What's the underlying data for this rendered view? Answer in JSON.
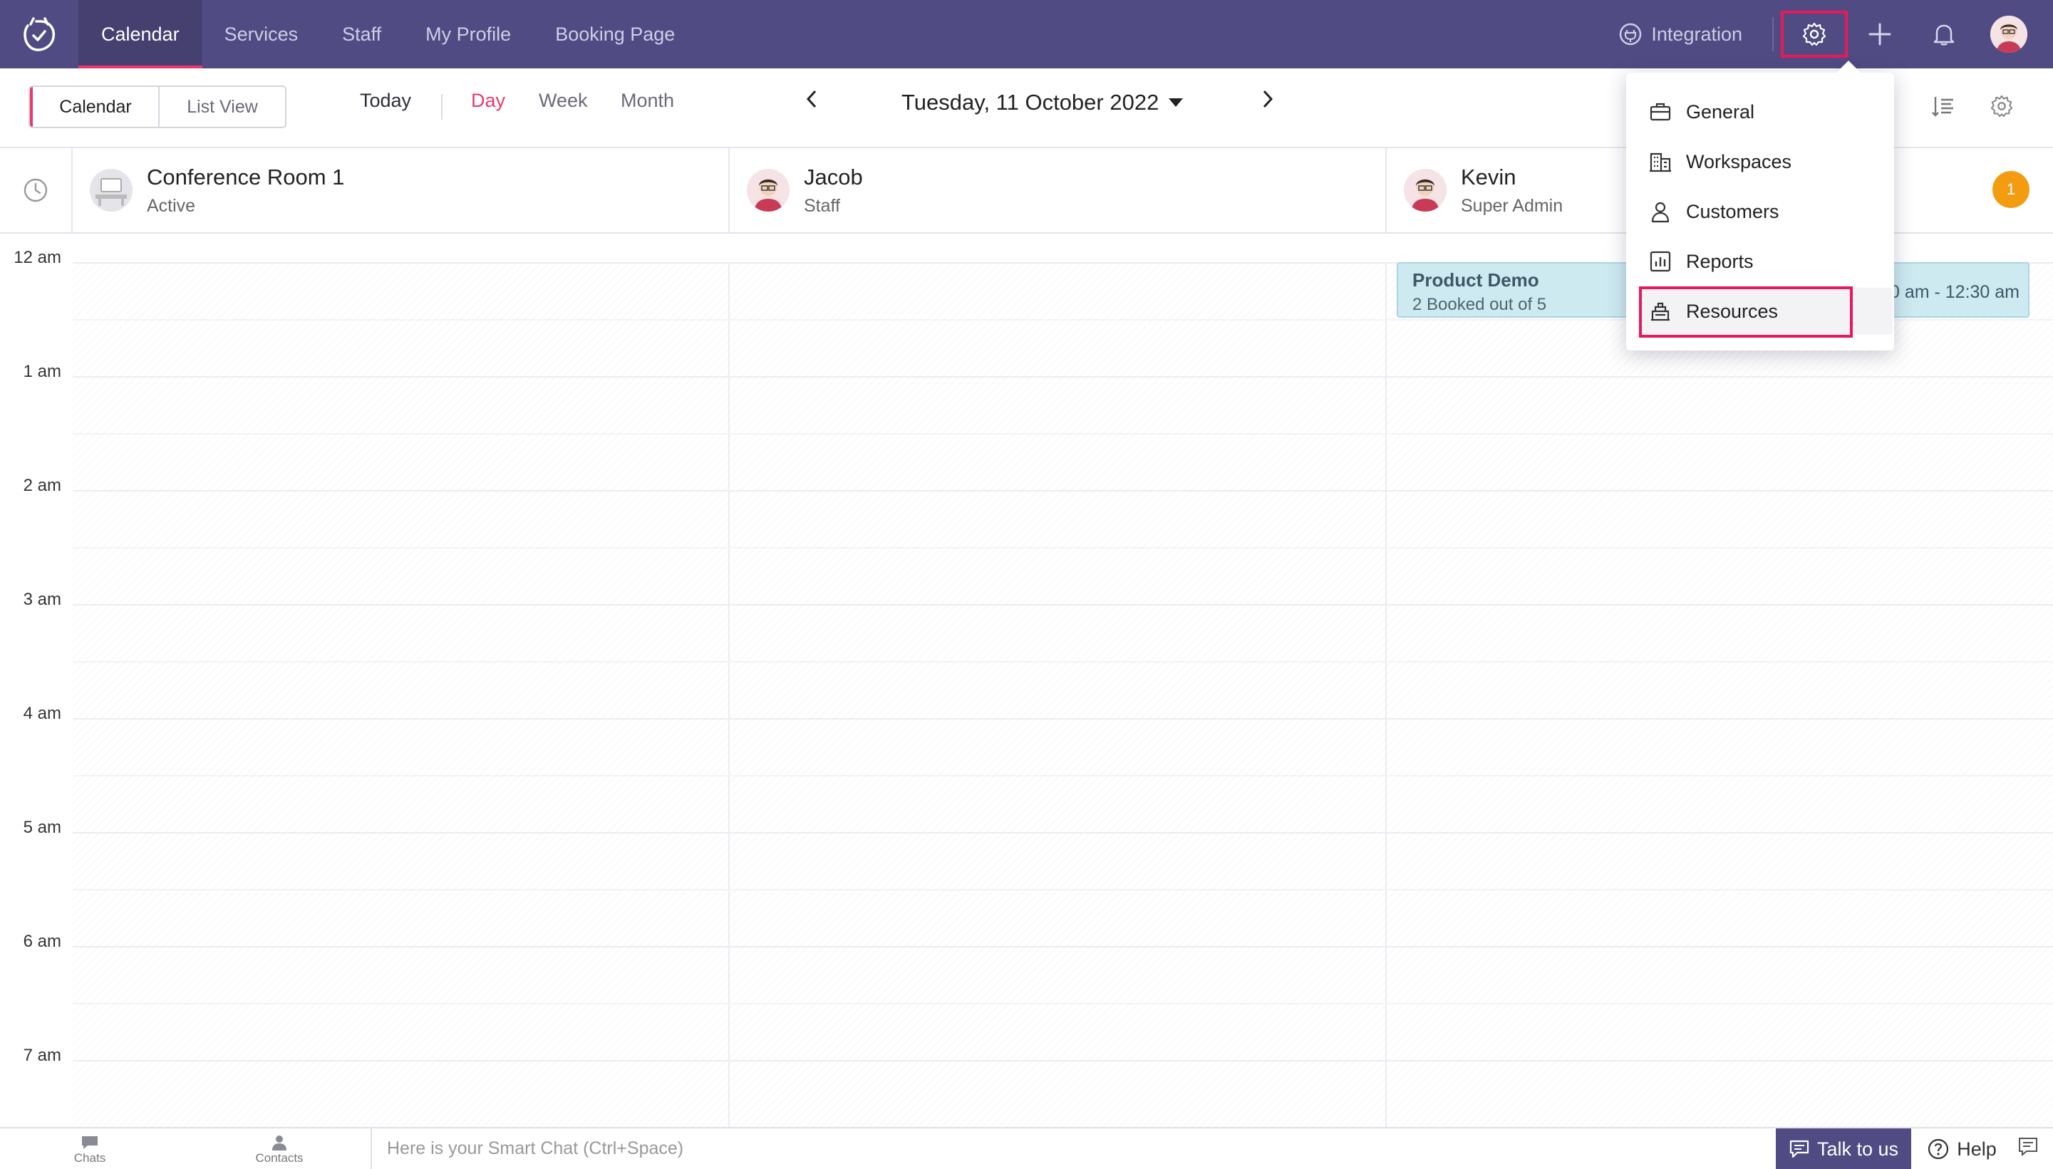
{
  "nav": {
    "tabs": [
      "Calendar",
      "Services",
      "Staff",
      "My Profile",
      "Booking Page"
    ],
    "integration_label": "Integration",
    "accent_color": "#514b84",
    "highlight_color": "#e8195a"
  },
  "toolbar": {
    "view_modes": [
      "Calendar",
      "List View"
    ],
    "today_label": "Today",
    "ranges": [
      "Day",
      "Week",
      "Month"
    ],
    "active_range": "Day",
    "date_label": "Tuesday, 11 October 2022"
  },
  "resources": [
    {
      "name": "Conference Room 1",
      "role": "Active"
    },
    {
      "name": "Jacob",
      "role": "Staff"
    },
    {
      "name": "Kevin",
      "role": "Super Admin"
    }
  ],
  "badge_count": "1",
  "times": [
    "12 am",
    "1 am",
    "2 am",
    "3 am",
    "4 am",
    "5 am",
    "6 am",
    "7 am"
  ],
  "event": {
    "title": "Product Demo",
    "subtitle": "2 Booked out of 5",
    "time": "00 am - 12:30 am"
  },
  "settings_menu": {
    "items": [
      "General",
      "Workspaces",
      "Customers",
      "Reports",
      "Resources"
    ],
    "highlighted": "Resources"
  },
  "bottom": {
    "chats_label": "Chats",
    "contacts_label": "Contacts",
    "smartchat_placeholder": "Here is your Smart Chat (Ctrl+Space)",
    "talk_label": "Talk to us",
    "help_label": "Help"
  }
}
